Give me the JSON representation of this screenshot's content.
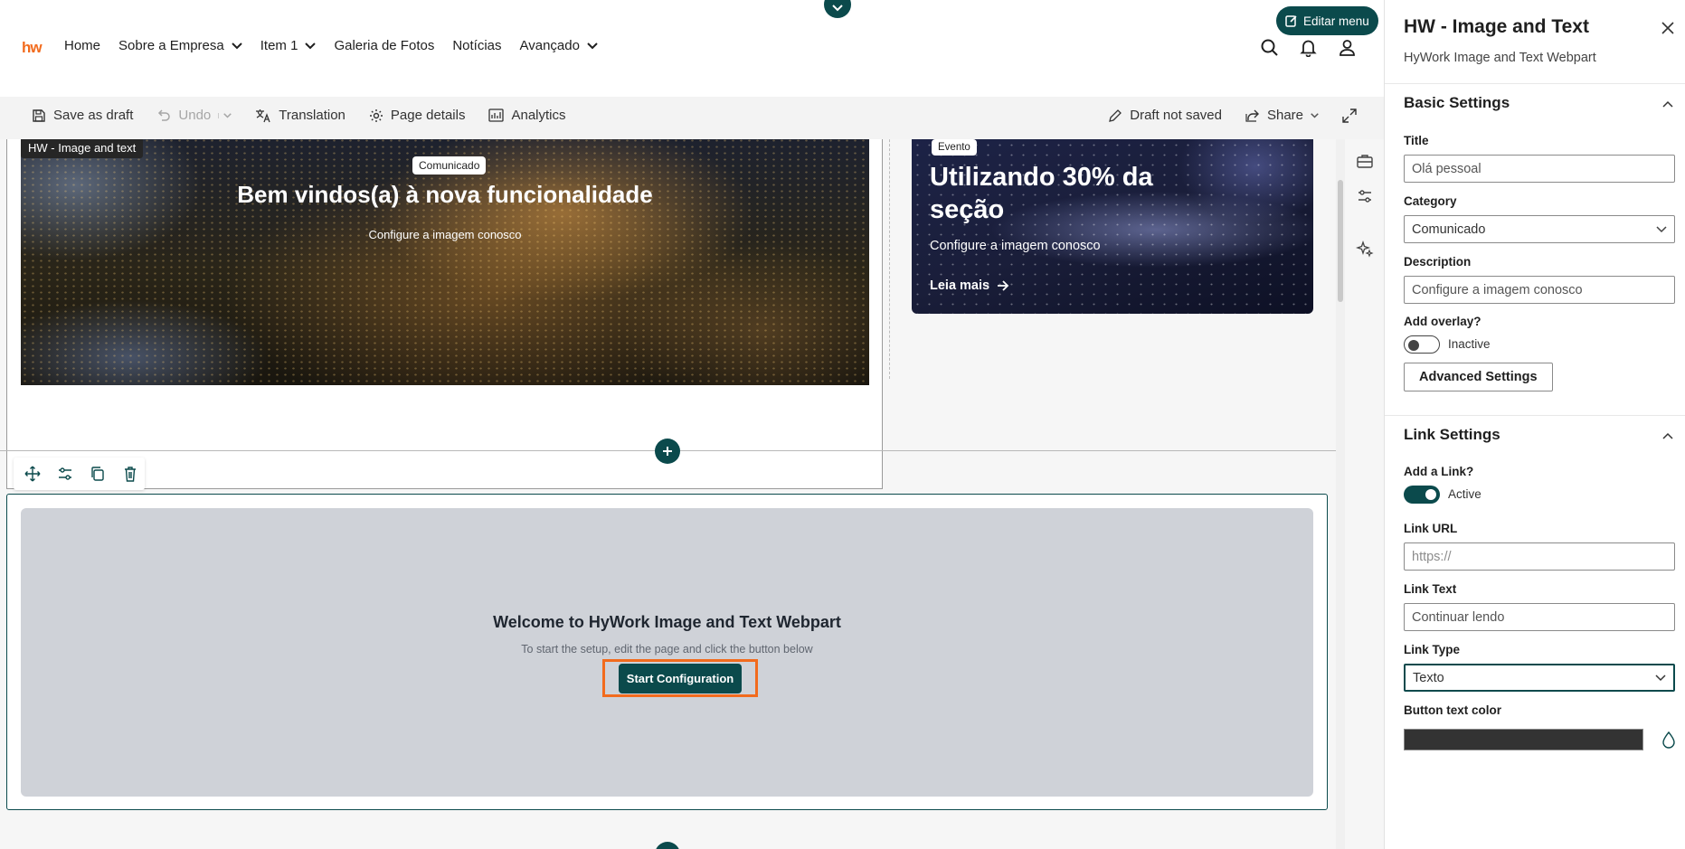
{
  "site": {
    "logo": "hw",
    "nav": [
      {
        "label": "Home",
        "dropdown": false
      },
      {
        "label": "Sobre a Empresa",
        "dropdown": true
      },
      {
        "label": "Item 1",
        "dropdown": true
      },
      {
        "label": "Galeria de Fotos",
        "dropdown": false
      },
      {
        "label": "Notícias",
        "dropdown": false
      },
      {
        "label": "Avançado",
        "dropdown": true
      }
    ],
    "edit_menu_label": "Editar menu",
    "icons": [
      "search-icon",
      "bell-icon",
      "user-icon"
    ]
  },
  "commandbar": {
    "save_draft": "Save as draft",
    "undo": "Undo",
    "translation": "Translation",
    "page_details": "Page details",
    "analytics": "Analytics",
    "draft_status": "Draft not saved",
    "share": "Share"
  },
  "canvas": {
    "webpart_label": "HW - Image and text",
    "hero1": {
      "category": "Comunicado",
      "title": "Bem vindos(a) à nova funcionalidade",
      "description": "Configure a imagem conosco"
    },
    "hero2": {
      "category": "Evento",
      "title": "Utilizando 30% da seção",
      "description": "Configure a imagem conosco",
      "link": "Leia mais"
    },
    "placeholder": {
      "title": "Welcome to HyWork Image and Text Webpart",
      "subtitle": "To start the setup, edit the page and click the button below",
      "button": "Start Configuration"
    }
  },
  "pane": {
    "title": "HW - Image and Text",
    "subtitle": "HyWork Image and Text Webpart",
    "basic": {
      "heading": "Basic Settings",
      "title_label": "Title",
      "title_value": "Olá pessoal",
      "category_label": "Category",
      "category_value": "Comunicado",
      "description_label": "Description",
      "description_value": "Configure a imagem conosco",
      "overlay_label": "Add overlay?",
      "overlay_state": "Inactive",
      "advanced_button": "Advanced Settings"
    },
    "link": {
      "heading": "Link Settings",
      "add_link_label": "Add a Link?",
      "add_link_state": "Active",
      "url_label": "Link URL",
      "url_placeholder": "https://",
      "text_label": "Link Text",
      "text_value": "Continuar lendo",
      "type_label": "Link Type",
      "type_value": "Texto",
      "color_label": "Button text color"
    }
  },
  "colors": {
    "accent": "#0b4a4c",
    "brand_orange": "#f26b1d",
    "button_text_color": "#333333"
  }
}
